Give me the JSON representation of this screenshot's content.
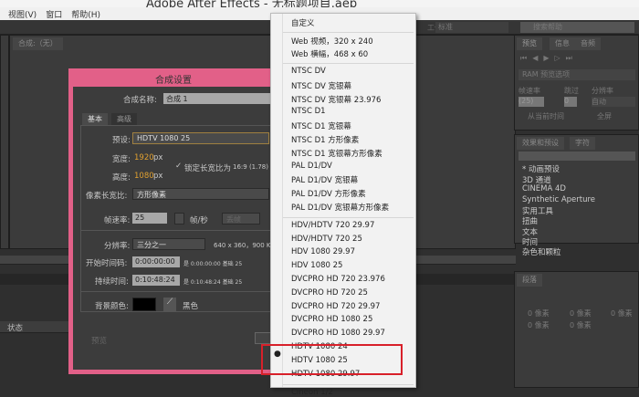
{
  "window": {
    "title": "Adobe After Effects - 无标题项目.aep"
  },
  "menu": [
    "视图(V)",
    "窗口",
    "帮助(H)"
  ],
  "comp_panel": {
    "tab": "合成:（无）"
  },
  "dialog": {
    "title": "合成设置",
    "name_label": "合成名称:",
    "name_value": "合成 1",
    "tabs": [
      "基本",
      "高级"
    ],
    "preset_label": "预设:",
    "preset_value": "HDTV 1080 25",
    "width_label": "宽度:",
    "width_value": "1920",
    "height_label": "高度:",
    "height_value": "1080",
    "px": "px",
    "lock_label": "锁定长宽比为",
    "lock_ratio": "16:9 (1.78)",
    "par_label": "像素长宽比:",
    "par_value": "方形像素",
    "fps_label": "帧速率:",
    "fps_value": "25",
    "fps_unit": "帧/秒",
    "fps_drop": "丢帧",
    "res_label": "分辨率:",
    "res_value": "三分之一",
    "res_info": "640 x 360，900 K",
    "start_label": "开始时间码:",
    "start_value": "0:00:00:00",
    "start_info": "是 0:00:00:00  基础 25",
    "dur_label": "持续时间:",
    "dur_value": "0:10:48:24",
    "dur_info": "是 0:10:48:24  基础 25",
    "bg_label": "背景颜色:",
    "bg_name": "黑色",
    "bg_color": "#000000",
    "preview_label": "预览"
  },
  "dropdown": {
    "groups": [
      [
        "自定义"
      ],
      [
        "Web 视频，320 x 240",
        "Web 横幅，468 x 60"
      ],
      [
        "NTSC DV",
        "NTSC DV 宽银幕",
        "NTSC DV 宽银幕 23.976",
        "NTSC D1",
        "NTSC D1 宽银幕",
        "NTSC D1 方形像素",
        "NTSC D1 宽银幕方形像素",
        "PAL D1/DV",
        "PAL D1/DV 宽银幕",
        "PAL D1/DV 方形像素",
        "PAL D1/DV 宽银幕方形像素"
      ],
      [
        "HDV/HDTV 720 29.97",
        "HDV/HDTV 720 25",
        "HDV 1080 29.97",
        "HDV 1080 25",
        "DVCPRO HD 720 23.976",
        "DVCPRO HD 720 25",
        "DVCPRO HD 720 29.97",
        "DVCPRO HD 1080 25",
        "DVCPRO HD 1080 29.97",
        "HDTV 1080 24",
        "HDTV 1080 25",
        "HDTV 1080 29.97"
      ],
      [
        "Cineon 1/2"
      ]
    ],
    "selected": "HDTV 1080 25"
  },
  "preview_panel": {
    "tabs": [
      "预览",
      "信息",
      "音频"
    ],
    "ram_label": "RAM 预览选项",
    "fps_label": "帧速率",
    "skip_label": "跳过",
    "res_label": "分辨率",
    "fps_value": "(25)",
    "skip_value": "0",
    "res_value": "自动",
    "from_current": "从当前时间",
    "fullscreen": "全屏"
  },
  "effects_panel": {
    "tabs": [
      "效果和预设",
      "字符"
    ],
    "items": [
      "* 动画预设",
      "3D 通道",
      "CINEMA 4D",
      "Synthetic Aperture",
      "实用工具",
      "扭曲",
      "文本",
      "时间",
      "杂色和颗粒"
    ]
  },
  "paragraph_panel": {
    "tab": "段落",
    "values": [
      "0 像素",
      "0 像素",
      "0 像素",
      "0 像素",
      "0 像素"
    ]
  },
  "workspace": {
    "label": "工作区:",
    "value": "标准",
    "search_placeholder": "搜索帮助"
  },
  "timeline": {
    "status_label": "状态"
  }
}
